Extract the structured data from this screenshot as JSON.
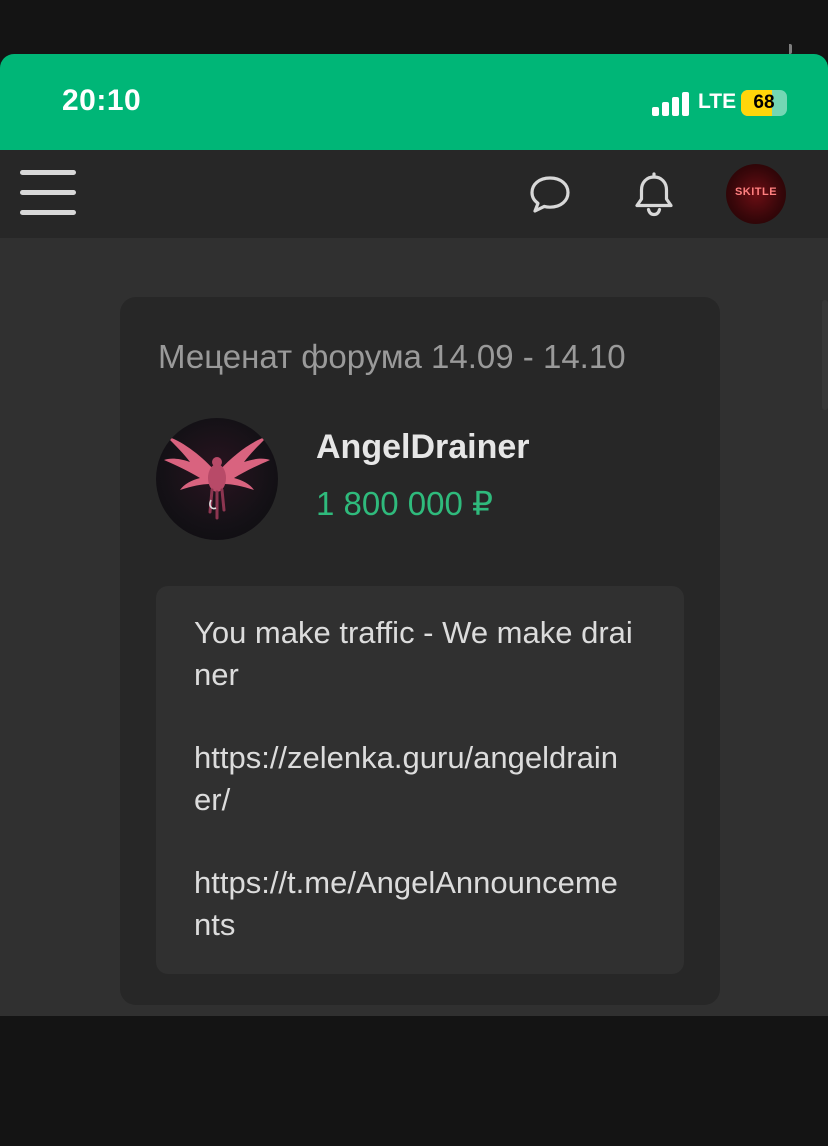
{
  "status_bar": {
    "time": "20:10",
    "network": "LTE",
    "battery_level": "68",
    "background_color": "#00b677"
  },
  "header": {
    "menu_icon": "hamburger-menu-icon",
    "chat_icon": "chat-bubble-icon",
    "notifications_icon": "bell-icon",
    "avatar_text": "SKITLE"
  },
  "sponsor_card": {
    "title": "Меценат форума 14.09 - 14.10",
    "username": "AngelDrainer",
    "amount": "1 800 000 ₽",
    "amount_color": "#2fba7c",
    "message": {
      "line1": "You make traffic - We make drainer",
      "link1": "https://zelenka.guru/angeldrainer/",
      "link2": "https://t.me/AngelAnnouncements"
    }
  }
}
